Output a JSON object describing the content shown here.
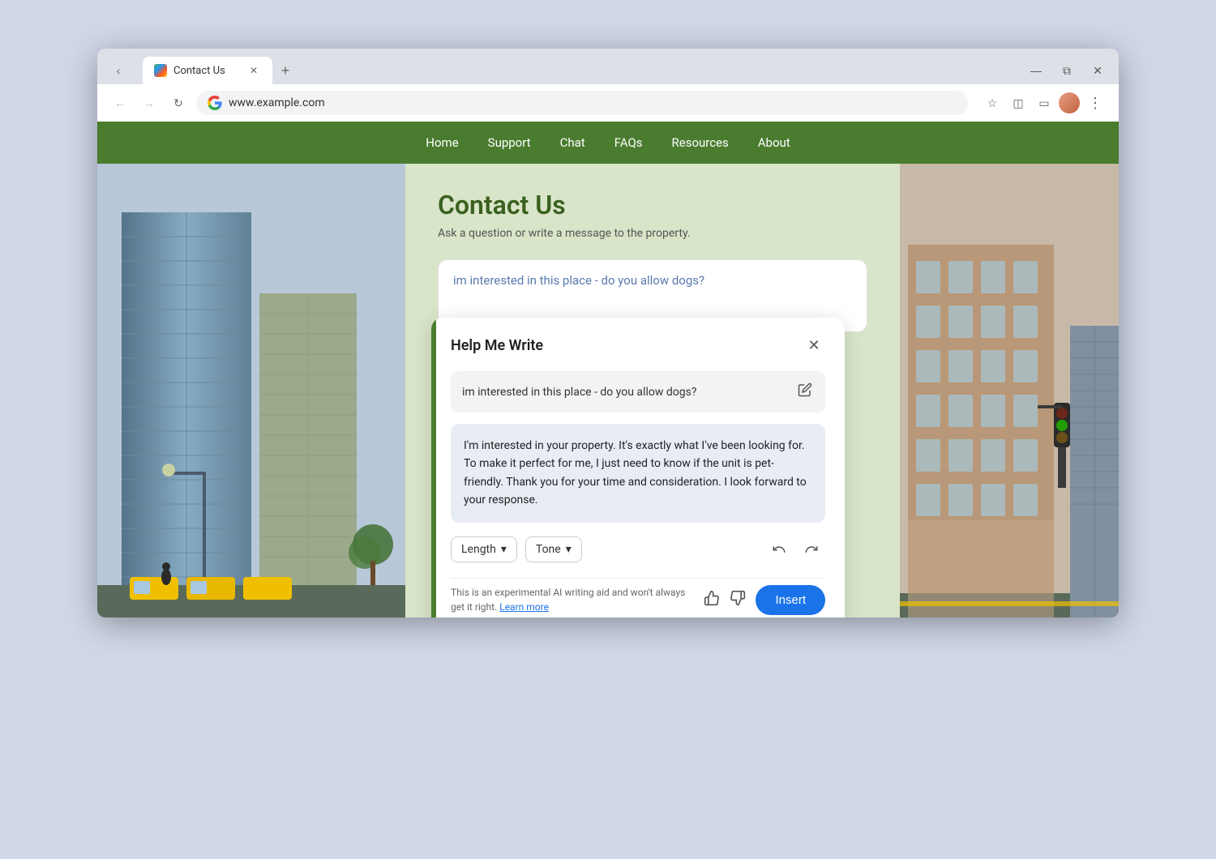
{
  "browser": {
    "tab_title": "Contact Us",
    "url": "www.example.com",
    "back_label": "←",
    "forward_label": "→",
    "reload_label": "↻",
    "new_tab_label": "+",
    "minimize_label": "—",
    "maximize_label": "⧉",
    "close_label": "✕",
    "menu_label": "⋮"
  },
  "nav": {
    "items": [
      {
        "label": "Home",
        "id": "home"
      },
      {
        "label": "Support",
        "id": "support"
      },
      {
        "label": "Chat",
        "id": "chat"
      },
      {
        "label": "FAQs",
        "id": "faqs"
      },
      {
        "label": "Resources",
        "id": "resources"
      },
      {
        "label": "About",
        "id": "about"
      }
    ]
  },
  "contact": {
    "title": "Contact Us",
    "subtitle": "Ask a question or write a message to the property.",
    "message_value": "im interested in this place - do you allow dogs?"
  },
  "help_me_write": {
    "title": "Help Me Write",
    "close_label": "✕",
    "input_text": "im interested in this place - do you allow dogs?",
    "generated_text": "I'm interested in your property. It's exactly what I've been looking for. To make it perfect for me, I just need to know if the unit is pet-friendly. Thank you for your time and consideration. I look forward to your response.",
    "length_label": "Length",
    "tone_label": "Tone",
    "length_dropdown_icon": "▾",
    "tone_dropdown_icon": "▾",
    "undo_label": "↺",
    "redo_label": "↻",
    "edit_icon": "✏",
    "disclaimer": "This is an experimental AI writing aid and won't always get it right.",
    "learn_more_label": "Learn more",
    "thumbup_icon": "👍",
    "thumbdown_icon": "👎",
    "insert_label": "Insert"
  }
}
